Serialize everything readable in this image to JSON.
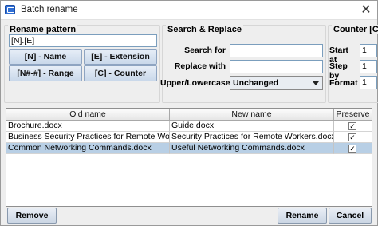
{
  "window": {
    "title": "Batch rename",
    "close_glyph": "✕"
  },
  "rename_pattern": {
    "legend": "Rename pattern",
    "pattern_value": "[N].[E]",
    "buttons": {
      "name": "[N] - Name",
      "extension": "[E] - Extension",
      "range": "[N#-#] - Range",
      "counter": "[C] - Counter"
    }
  },
  "search_replace": {
    "legend": "Search & Replace",
    "search_label": "Search for",
    "search_value": "",
    "replace_label": "Replace with",
    "replace_value": "",
    "case_label": "Upper/Lowercase",
    "case_selected": "Unchanged"
  },
  "counter": {
    "legend": "Counter [C]",
    "start_label": "Start at",
    "start_value": "1",
    "step_label": "Step by",
    "step_value": "1",
    "format_label": "Format",
    "format_value": "1"
  },
  "table": {
    "columns": [
      "Old name",
      "New name",
      "Preserve"
    ],
    "rows": [
      {
        "old": "Brochure.docx",
        "new": "Guide.docx",
        "preserve": true,
        "selected": false
      },
      {
        "old": "Business Security Practices for Remote Workers.docx",
        "new": "Security Practices for Remote Workers.docx",
        "preserve": true,
        "selected": false
      },
      {
        "old": "Common Networking Commands.docx",
        "new": "Useful Networking Commands.docx",
        "preserve": true,
        "selected": true
      }
    ]
  },
  "footer": {
    "remove_label": "Remove",
    "rename_label": "Rename",
    "cancel_label": "Cancel"
  }
}
